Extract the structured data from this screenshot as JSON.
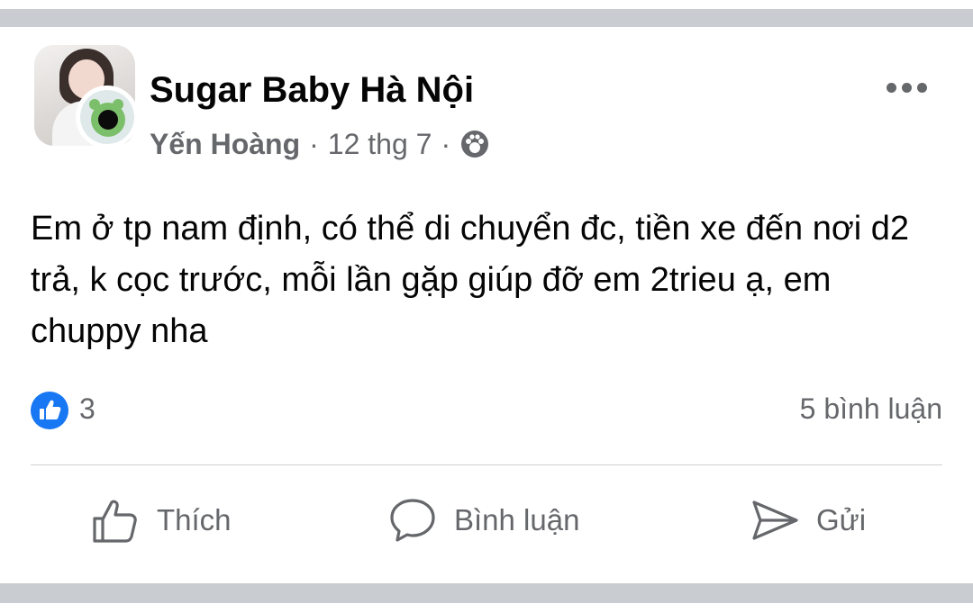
{
  "post": {
    "group_name": "Sugar Baby Hà Nội",
    "author": "Yến Hoàng",
    "separator": "·",
    "date": "12 thg 7",
    "privacy_icon": "group-members-icon",
    "text": "Em ở tp nam định, có thể di chuyển đc, tiền xe đến nơi d2 trả, k cọc trước, mỗi lần gặp giúp đỡ em 2trieu ạ, em chuppy nha"
  },
  "reactions": {
    "like_count": "3",
    "comments_label": "5 bình luận"
  },
  "actions": {
    "like_label": "Thích",
    "comment_label": "Bình luận",
    "share_label": "Gửi"
  },
  "colors": {
    "text_primary": "#050505",
    "text_secondary": "#65676b",
    "like_blue": "#1877f2",
    "separator_gray": "#c9ccd1"
  }
}
